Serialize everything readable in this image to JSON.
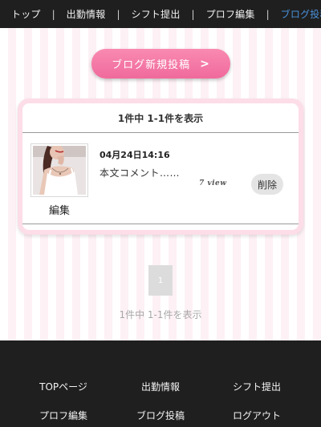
{
  "topnav": {
    "items": [
      {
        "label": "トップ"
      },
      {
        "label": "出勤情報"
      },
      {
        "label": "シフト提出"
      },
      {
        "label": "プロフ編集"
      },
      {
        "label": "ブログ投稿"
      }
    ],
    "separator": "|",
    "active_color": "#4a90d9"
  },
  "new_post_button": {
    "label": "ブログ新規投稿",
    "chevron": ">"
  },
  "card": {
    "header": "1件中 1-1件を表示",
    "posts": [
      {
        "date": "04月24日14:16",
        "body": "本文コメント……",
        "views": "7 view",
        "edit_label": "編集",
        "delete_label": "削除"
      }
    ]
  },
  "pagination": {
    "current_page": "1",
    "summary": "1件中 1-1件を表示"
  },
  "footer": {
    "links": [
      {
        "label": "TOPページ"
      },
      {
        "label": "出勤情報"
      },
      {
        "label": "シフト提出"
      },
      {
        "label": "プロフ編集"
      },
      {
        "label": "ブログ投稿"
      },
      {
        "label": "ログアウト"
      }
    ]
  },
  "colors": {
    "accent_pink": "#f27ca7",
    "dark_bar": "#1f1f1f",
    "card_border": "#fcdde8"
  }
}
